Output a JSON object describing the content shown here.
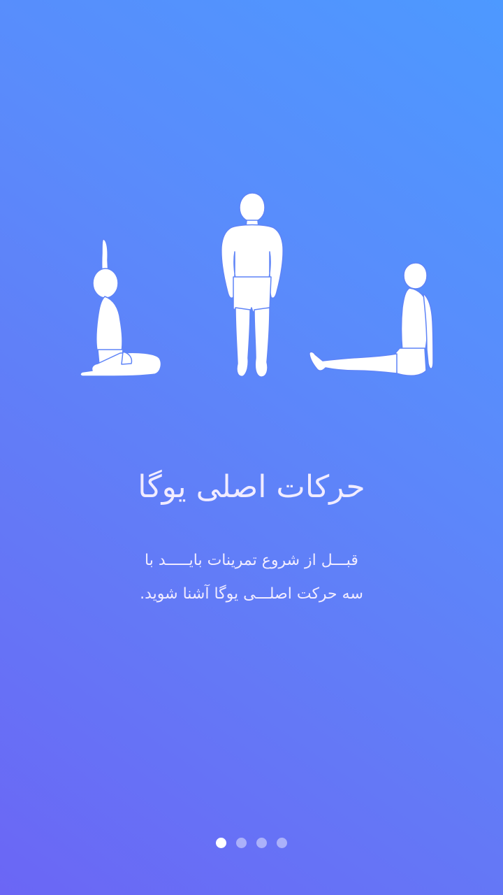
{
  "onboarding": {
    "title": "حرکات اصلی یوگا",
    "description_line1": "قبـــل از شروع تمرینات بایـــــد با",
    "description_line2": "سه حرکت اصلـــی یوگا آشنا شوید.",
    "illustration_icons": [
      "kneeling-arm-raise-pose-icon",
      "standing-pose-icon",
      "seated-leg-stretch-pose-icon"
    ],
    "figure_color": "#ffffff",
    "text_color": "#f1ecff",
    "gradient_colors": [
      "#4d99ff",
      "#6b66f5"
    ]
  },
  "pager": {
    "count": 4,
    "active_index": 0
  }
}
